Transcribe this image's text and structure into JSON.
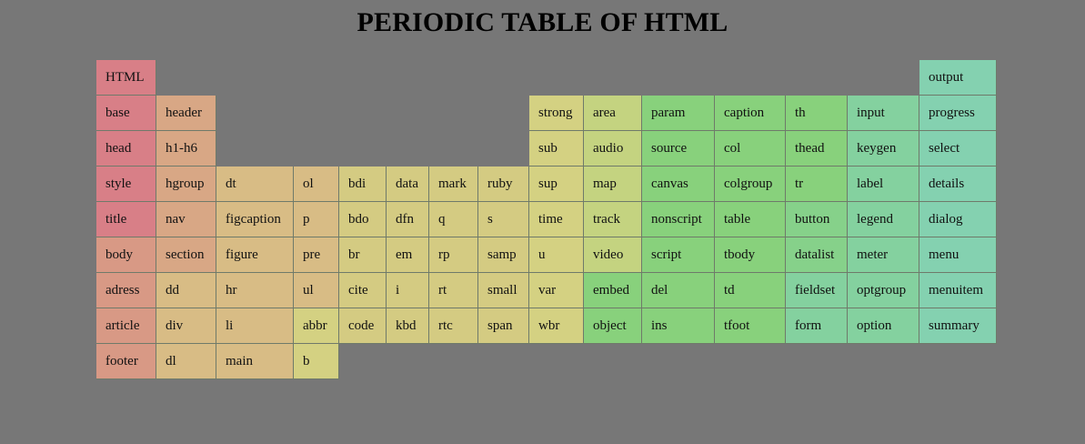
{
  "title": "PERIODIC TABLE OF HTML",
  "palette": {
    "background": "#777777",
    "c0": "#d87f87",
    "c1": "#d89985",
    "c2": "#d8a785",
    "c3": "#d8bc85",
    "c4": "#d8c385",
    "c5": "#d4cb82",
    "c6": "#d4d182",
    "c7": "#c4d380",
    "c8": "#88d17c",
    "c9": "#86d18a",
    "c10": "#84d19f",
    "c11": "#84d1b0"
  },
  "elements": [
    {
      "label": "HTML",
      "col": 0,
      "row": 0,
      "color": "c0"
    },
    {
      "label": "output",
      "col": 14,
      "row": 0,
      "color": "c11"
    },
    {
      "label": "base",
      "col": 0,
      "row": 1,
      "color": "c0"
    },
    {
      "label": "header",
      "col": 1,
      "row": 1,
      "color": "c2"
    },
    {
      "label": "strong",
      "col": 8,
      "row": 1,
      "color": "c6"
    },
    {
      "label": "area",
      "col": 9,
      "row": 1,
      "color": "c7"
    },
    {
      "label": "param",
      "col": 10,
      "row": 1,
      "color": "c8"
    },
    {
      "label": "caption",
      "col": 11,
      "row": 1,
      "color": "c8"
    },
    {
      "label": "th",
      "col": 12,
      "row": 1,
      "color": "c8"
    },
    {
      "label": "input",
      "col": 13,
      "row": 1,
      "color": "c10"
    },
    {
      "label": "progress",
      "col": 14,
      "row": 1,
      "color": "c11"
    },
    {
      "label": "head",
      "col": 0,
      "row": 2,
      "color": "c0"
    },
    {
      "label": "h1-h6",
      "col": 1,
      "row": 2,
      "color": "c2"
    },
    {
      "label": "sub",
      "col": 8,
      "row": 2,
      "color": "c6"
    },
    {
      "label": "audio",
      "col": 9,
      "row": 2,
      "color": "c7"
    },
    {
      "label": "source",
      "col": 10,
      "row": 2,
      "color": "c8"
    },
    {
      "label": "col",
      "col": 11,
      "row": 2,
      "color": "c8"
    },
    {
      "label": "thead",
      "col": 12,
      "row": 2,
      "color": "c8"
    },
    {
      "label": "keygen",
      "col": 13,
      "row": 2,
      "color": "c10"
    },
    {
      "label": "select",
      "col": 14,
      "row": 2,
      "color": "c11"
    },
    {
      "label": "style",
      "col": 0,
      "row": 3,
      "color": "c0"
    },
    {
      "label": "hgroup",
      "col": 1,
      "row": 3,
      "color": "c2"
    },
    {
      "label": "dt",
      "col": 2,
      "row": 3,
      "color": "c3"
    },
    {
      "label": "ol",
      "col": 3,
      "row": 3,
      "color": "c3"
    },
    {
      "label": "bdi",
      "col": 4,
      "row": 3,
      "color": "c5"
    },
    {
      "label": "data",
      "col": 5,
      "row": 3,
      "color": "c5"
    },
    {
      "label": "mark",
      "col": 6,
      "row": 3,
      "color": "c5"
    },
    {
      "label": "ruby",
      "col": 7,
      "row": 3,
      "color": "c5"
    },
    {
      "label": "sup",
      "col": 8,
      "row": 3,
      "color": "c6"
    },
    {
      "label": "map",
      "col": 9,
      "row": 3,
      "color": "c7"
    },
    {
      "label": "canvas",
      "col": 10,
      "row": 3,
      "color": "c8"
    },
    {
      "label": "colgroup",
      "col": 11,
      "row": 3,
      "color": "c8"
    },
    {
      "label": "tr",
      "col": 12,
      "row": 3,
      "color": "c8"
    },
    {
      "label": "label",
      "col": 13,
      "row": 3,
      "color": "c10"
    },
    {
      "label": "details",
      "col": 14,
      "row": 3,
      "color": "c11"
    },
    {
      "label": "title",
      "col": 0,
      "row": 4,
      "color": "c0"
    },
    {
      "label": "nav",
      "col": 1,
      "row": 4,
      "color": "c2"
    },
    {
      "label": "figcaption",
      "col": 2,
      "row": 4,
      "color": "c3"
    },
    {
      "label": "p",
      "col": 3,
      "row": 4,
      "color": "c3"
    },
    {
      "label": "bdo",
      "col": 4,
      "row": 4,
      "color": "c5"
    },
    {
      "label": "dfn",
      "col": 5,
      "row": 4,
      "color": "c5"
    },
    {
      "label": "q",
      "col": 6,
      "row": 4,
      "color": "c5"
    },
    {
      "label": "s",
      "col": 7,
      "row": 4,
      "color": "c5"
    },
    {
      "label": "time",
      "col": 8,
      "row": 4,
      "color": "c6"
    },
    {
      "label": "track",
      "col": 9,
      "row": 4,
      "color": "c7"
    },
    {
      "label": "nonscript",
      "col": 10,
      "row": 4,
      "color": "c8"
    },
    {
      "label": "table",
      "col": 11,
      "row": 4,
      "color": "c8"
    },
    {
      "label": "button",
      "col": 12,
      "row": 4,
      "color": "c9"
    },
    {
      "label": "legend",
      "col": 13,
      "row": 4,
      "color": "c10"
    },
    {
      "label": "dialog",
      "col": 14,
      "row": 4,
      "color": "c11"
    },
    {
      "label": "body",
      "col": 0,
      "row": 5,
      "color": "c1"
    },
    {
      "label": "section",
      "col": 1,
      "row": 5,
      "color": "c2"
    },
    {
      "label": "figure",
      "col": 2,
      "row": 5,
      "color": "c3"
    },
    {
      "label": "pre",
      "col": 3,
      "row": 5,
      "color": "c3"
    },
    {
      "label": "br",
      "col": 4,
      "row": 5,
      "color": "c5"
    },
    {
      "label": "em",
      "col": 5,
      "row": 5,
      "color": "c5"
    },
    {
      "label": "rp",
      "col": 6,
      "row": 5,
      "color": "c5"
    },
    {
      "label": "samp",
      "col": 7,
      "row": 5,
      "color": "c5"
    },
    {
      "label": "u",
      "col": 8,
      "row": 5,
      "color": "c6"
    },
    {
      "label": "video",
      "col": 9,
      "row": 5,
      "color": "c7"
    },
    {
      "label": "script",
      "col": 10,
      "row": 5,
      "color": "c8"
    },
    {
      "label": "tbody",
      "col": 11,
      "row": 5,
      "color": "c8"
    },
    {
      "label": "datalist",
      "col": 12,
      "row": 5,
      "color": "c9"
    },
    {
      "label": "meter",
      "col": 13,
      "row": 5,
      "color": "c10"
    },
    {
      "label": "menu",
      "col": 14,
      "row": 5,
      "color": "c11"
    },
    {
      "label": "adress",
      "col": 0,
      "row": 6,
      "color": "c1"
    },
    {
      "label": "dd",
      "col": 1,
      "row": 6,
      "color": "c3"
    },
    {
      "label": "hr",
      "col": 2,
      "row": 6,
      "color": "c3"
    },
    {
      "label": "ul",
      "col": 3,
      "row": 6,
      "color": "c3"
    },
    {
      "label": "cite",
      "col": 4,
      "row": 6,
      "color": "c5"
    },
    {
      "label": "i",
      "col": 5,
      "row": 6,
      "color": "c5"
    },
    {
      "label": "rt",
      "col": 6,
      "row": 6,
      "color": "c5"
    },
    {
      "label": "small",
      "col": 7,
      "row": 6,
      "color": "c5"
    },
    {
      "label": "var",
      "col": 8,
      "row": 6,
      "color": "c6"
    },
    {
      "label": "embed",
      "col": 9,
      "row": 6,
      "color": "c8"
    },
    {
      "label": "del",
      "col": 10,
      "row": 6,
      "color": "c8"
    },
    {
      "label": "td",
      "col": 11,
      "row": 6,
      "color": "c8"
    },
    {
      "label": "fieldset",
      "col": 12,
      "row": 6,
      "color": "c10"
    },
    {
      "label": "optgroup",
      "col": 13,
      "row": 6,
      "color": "c10"
    },
    {
      "label": "menuitem",
      "col": 14,
      "row": 6,
      "color": "c11"
    },
    {
      "label": "article",
      "col": 0,
      "row": 7,
      "color": "c1"
    },
    {
      "label": "div",
      "col": 1,
      "row": 7,
      "color": "c3"
    },
    {
      "label": "li",
      "col": 2,
      "row": 7,
      "color": "c3"
    },
    {
      "label": "abbr",
      "col": 3,
      "row": 7,
      "color": "c6"
    },
    {
      "label": "code",
      "col": 4,
      "row": 7,
      "color": "c5"
    },
    {
      "label": "kbd",
      "col": 5,
      "row": 7,
      "color": "c5"
    },
    {
      "label": "rtc",
      "col": 6,
      "row": 7,
      "color": "c5"
    },
    {
      "label": "span",
      "col": 7,
      "row": 7,
      "color": "c5"
    },
    {
      "label": "wbr",
      "col": 8,
      "row": 7,
      "color": "c6"
    },
    {
      "label": "object",
      "col": 9,
      "row": 7,
      "color": "c8"
    },
    {
      "label": "ins",
      "col": 10,
      "row": 7,
      "color": "c8"
    },
    {
      "label": "tfoot",
      "col": 11,
      "row": 7,
      "color": "c8"
    },
    {
      "label": "form",
      "col": 12,
      "row": 7,
      "color": "c10"
    },
    {
      "label": "option",
      "col": 13,
      "row": 7,
      "color": "c10"
    },
    {
      "label": "summary",
      "col": 14,
      "row": 7,
      "color": "c11"
    },
    {
      "label": "footer",
      "col": 0,
      "row": 8,
      "color": "c1"
    },
    {
      "label": "dl",
      "col": 1,
      "row": 8,
      "color": "c3"
    },
    {
      "label": "main",
      "col": 2,
      "row": 8,
      "color": "c3"
    },
    {
      "label": "b",
      "col": 3,
      "row": 8,
      "color": "c6"
    }
  ]
}
